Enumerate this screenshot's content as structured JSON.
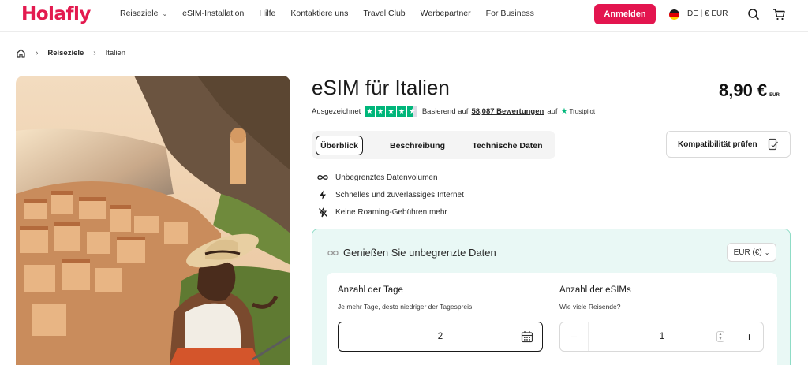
{
  "header": {
    "logo": "Holafly",
    "nav": [
      {
        "label": "Reiseziele",
        "dropdown": true
      },
      {
        "label": "eSIM-Installation"
      },
      {
        "label": "Hilfe"
      },
      {
        "label": "Kontaktiere uns"
      },
      {
        "label": "Travel Club"
      },
      {
        "label": "Werbepartner"
      },
      {
        "label": "For Business"
      }
    ],
    "login_label": "Anmelden",
    "locale": "DE | € EUR",
    "icons": [
      "search-icon",
      "cart-icon"
    ],
    "brand_color": "#e3154f"
  },
  "breadcrumb": {
    "items": [
      "Reiseziele",
      "Italien"
    ]
  },
  "product": {
    "title": "eSIM für Italien",
    "price": "8,90 €",
    "currency": "EUR",
    "rating": {
      "label": "Ausgezeichnet",
      "based_on": "Basierend auf",
      "reviews": "58,087 Bewertungen",
      "on": "auf",
      "provider": "Trustpilot",
      "stars": 4.5
    },
    "tabs": [
      {
        "label": "Überblick",
        "active": true
      },
      {
        "label": "Beschreibung"
      },
      {
        "label": "Technische Daten"
      }
    ],
    "compat_label": "Kompatibilität prüfen",
    "features": [
      {
        "icon": "infinity-icon",
        "text": "Unbegrenztes Datenvolumen"
      },
      {
        "icon": "lightning-icon",
        "text": "Schnelles und zuverlässiges Internet"
      },
      {
        "icon": "no-roaming-icon",
        "text": "Keine Roaming-Gebühren mehr"
      }
    ]
  },
  "plan": {
    "heading": "Genießen Sie unbegrenzte Daten",
    "currency_select": "EUR (€)",
    "days": {
      "label": "Anzahl der Tage",
      "hint": "Je mehr Tage, desto niedriger der Tagespreis",
      "value": "2"
    },
    "esims": {
      "label": "Anzahl der eSIMs",
      "hint": "Wie viele Reisende?",
      "value": "1",
      "minus": "−",
      "plus": "+"
    },
    "accent_color": "#8fdcc6"
  }
}
